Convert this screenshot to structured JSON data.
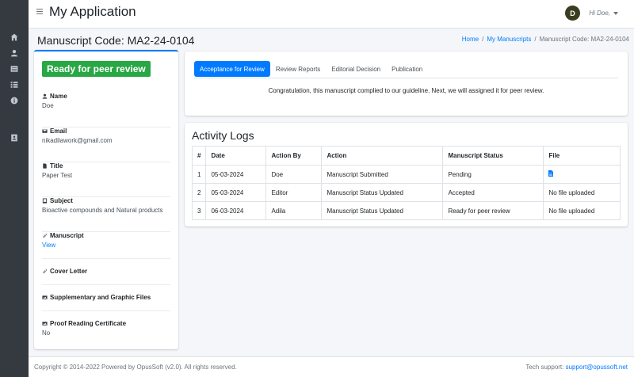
{
  "app": {
    "title": "My Application"
  },
  "user": {
    "initial": "D",
    "greeting": "Hi Doe,"
  },
  "page": {
    "title": "Manuscript Code: MA2-24-0104"
  },
  "breadcrumb": {
    "home": "Home",
    "sep1": "/",
    "manuscripts": "My Manuscripts",
    "sep2": "/",
    "current": "Manuscript Code: MA2-24-0104"
  },
  "sidebar": {
    "icons": [
      "home-icon",
      "user-icon",
      "list-alt-icon",
      "list-icon",
      "info-icon",
      "id-card-icon"
    ]
  },
  "summary": {
    "status": "Ready for peer review",
    "name_label": "Name",
    "name_value": "Doe",
    "email_label": "Email",
    "email_value": "nikadilawork@gmail.com",
    "title_label": "Title",
    "title_value": "Paper Test",
    "subject_label": "Subject",
    "subject_value": "Bioactive compounds and Natural products",
    "manuscript_label": "Manuscript",
    "manuscript_link": "View",
    "cover_label": "Cover Letter",
    "supplementary_label": "Supplementary and Graphic Files",
    "proof_label": "Proof Reading Certificate",
    "proof_value": "No"
  },
  "tabs": {
    "items": [
      "Acceptance for Review",
      "Review Reports",
      "Editorial Decision",
      "Publication"
    ],
    "message": "Congratulation, this manuscript complied to our guideline. Next, we will assigned it for peer review."
  },
  "logs": {
    "title": "Activity Logs",
    "headers": [
      "#",
      "Date",
      "Action By",
      "Action",
      "Manuscript Status",
      "File"
    ],
    "rows": [
      {
        "num": "1",
        "date": "05-03-2024",
        "by": "Doe",
        "action": "Manuscript Submitted",
        "status": "Pending",
        "file": ""
      },
      {
        "num": "2",
        "date": "05-03-2024",
        "by": "Editor",
        "action": "Manuscript Status Updated",
        "status": "Accepted",
        "file": "No file uploaded"
      },
      {
        "num": "3",
        "date": "06-03-2024",
        "by": "Adila",
        "action": "Manuscript Status Updated",
        "status": "Ready for peer review",
        "file": "No file uploaded"
      }
    ]
  },
  "footer": {
    "copyright": "Copyright © 2014-2022 Powered by OpusSoft (v2.0). All rights reserved.",
    "support_label": "Tech support:",
    "support_email": "support@opussoft.net"
  },
  "colors": {
    "sidebar": "#343a40",
    "accent": "#007bff",
    "success": "#28a745"
  }
}
